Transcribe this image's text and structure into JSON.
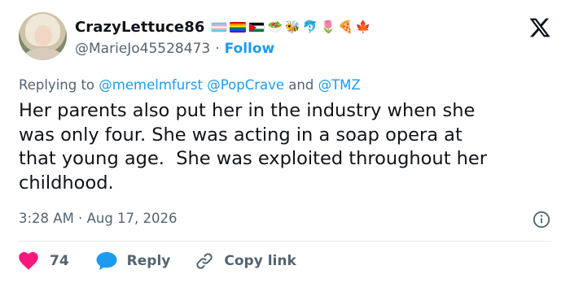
{
  "tweet": {
    "author": {
      "display_name": "CrazyLettuce86",
      "handle": "@MarieJo45528473",
      "flags": [
        "transgender-flag",
        "rainbow-flag",
        "palestine-flag"
      ],
      "name_emojis": [
        "🥗",
        "🐝",
        "🐬",
        "🌷",
        "🍕",
        "🍁"
      ]
    },
    "follow_label": "Follow",
    "separator": "·",
    "reply_to": {
      "prefix": "Replying to ",
      "mentions": [
        "@memelmfurst",
        "@PopCrave",
        "@TMZ"
      ],
      "and_word": " and "
    },
    "text": "Her parents also put her in the industry when she\nwas only four. She was acting in a soap opera at\nthat young age.  She was exploited throughout her\nchildhood.",
    "time": "3:28 AM",
    "date": "Aug 17, 2026",
    "likes": "74",
    "reply_label": "Reply",
    "copy_link_label": "Copy link"
  },
  "colors": {
    "accent": "#1d9bf0",
    "like_red": "#f91880",
    "text": "#0f1419",
    "muted": "#536471"
  }
}
